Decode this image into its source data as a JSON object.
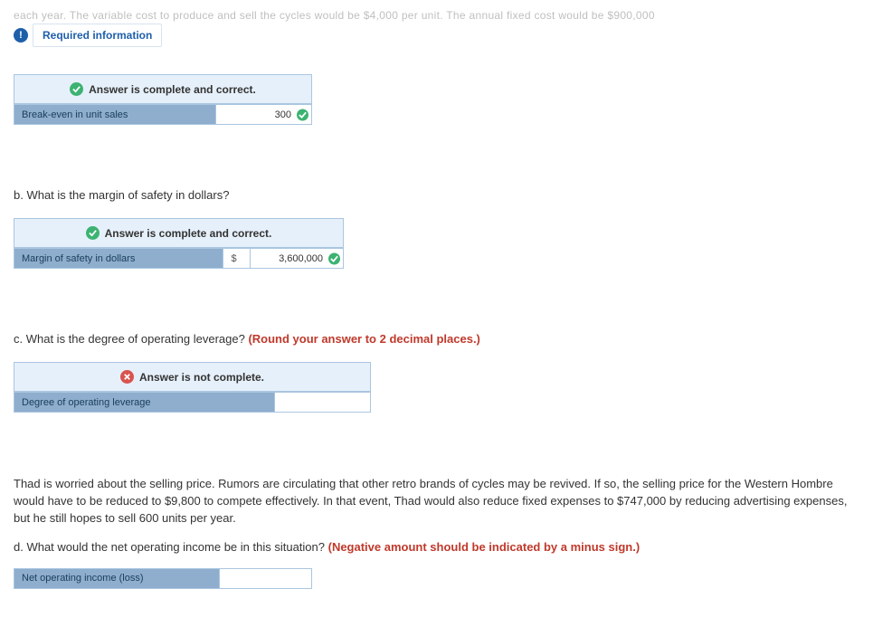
{
  "context_top": "each year. The variable cost to produce and sell the cycles would be $4,000 per unit. The annual fixed cost would be $900,000",
  "required_info": "Required information",
  "status_correct": "Answer is complete and correct.",
  "status_incomplete": "Answer is not complete.",
  "part_a": {
    "label": "Break-even in unit sales",
    "value": "300"
  },
  "part_b": {
    "question": "b. What is the margin of safety in dollars?",
    "label": "Margin of safety in dollars",
    "currency": "$",
    "value": "3,600,000"
  },
  "part_c": {
    "question_text": "c. What is the degree of operating leverage? ",
    "question_hint": "(Round your answer to 2 decimal places.)",
    "label": "Degree of operating leverage"
  },
  "paragraph": "Thad is worried about the selling price. Rumors are circulating that other retro brands of cycles may be revived. If so, the selling price for the Western Hombre would have to be reduced to $9,800 to compete effectively. In that event, Thad would also reduce fixed expenses to $747,000 by reducing advertising expenses, but he still hopes to sell 600 units per year.",
  "part_d": {
    "question_text": "d. What would the net operating income be in this situation? ",
    "question_hint": "(Negative amount should be indicated by a minus sign.)",
    "label": "Net operating income (loss)"
  }
}
